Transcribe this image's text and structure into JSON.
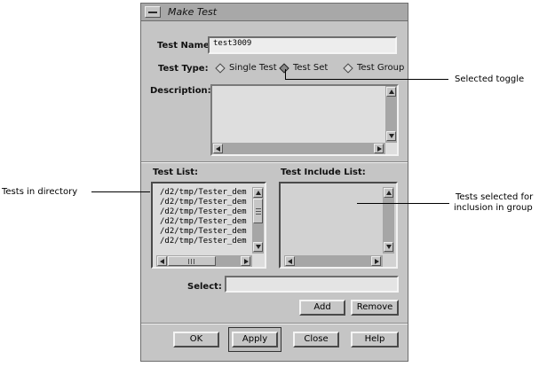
{
  "window": {
    "title": "Make Test"
  },
  "form": {
    "test_name_label": "Test Name:",
    "test_name_value": "test3009",
    "test_type_label": "Test Type:",
    "test_types": [
      {
        "label": "Single Test",
        "selected": false
      },
      {
        "label": "Test Set",
        "selected": true
      },
      {
        "label": "Test Group",
        "selected": false
      }
    ],
    "description_label": "Description:",
    "description_value": ""
  },
  "lists": {
    "test_list_label": "Test List:",
    "test_list_items": [
      "/d2/tmp/Tester_dem",
      "/d2/tmp/Tester_dem",
      "/d2/tmp/Tester_dem",
      "/d2/tmp/Tester_dem",
      "/d2/tmp/Tester_dem",
      "/d2/tmp/Tester_dem"
    ],
    "include_list_label": "Test Include List:",
    "include_list_items": []
  },
  "select": {
    "label": "Select:",
    "value": ""
  },
  "buttons": {
    "add": "Add",
    "remove": "Remove",
    "ok": "OK",
    "apply": "Apply",
    "close": "Close",
    "help": "Help"
  },
  "annotations": {
    "selected_toggle": "Selected toggle",
    "tests_in_directory": "Tests in directory",
    "tests_selected_line1": "Tests selected for",
    "tests_selected_line2": "inclusion in group"
  },
  "icons": {
    "window_menu": "window-menu-icon",
    "toggle": "diamond-toggle-icon",
    "scroll_up": "arrow-up-icon",
    "scroll_down": "arrow-down-icon",
    "scroll_left": "arrow-left-icon",
    "scroll_right": "arrow-right-icon"
  }
}
